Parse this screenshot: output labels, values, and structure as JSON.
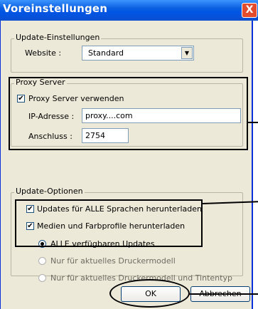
{
  "window": {
    "title": "Voreinstellungen",
    "close_glyph": "X"
  },
  "update_settings": {
    "legend": "Update-Einstellungen",
    "website_label": "Website :",
    "website_value": "Standard",
    "dropdown_glyph": "▼"
  },
  "proxy": {
    "legend": "Proxy Server",
    "use_proxy_label": "Proxy Server verwenden",
    "use_proxy_checked": true,
    "ip_label": "IP-Adresse :",
    "ip_value": "proxy....com",
    "port_label": "Anschluss :",
    "port_value": "2754"
  },
  "update_options": {
    "legend": "Update-Optionen",
    "all_languages_label": "Updates für ALLE Sprachen herunterladen",
    "all_languages_checked": true,
    "media_profiles_label": "Medien und Farbprofile herunterladen",
    "media_profiles_checked": true,
    "radio_all": "ALLE verfügbaren Updates",
    "radio_printer": "Nur für aktuelles Druckermodell",
    "radio_printer_ink": "Nur für aktuelles Druckermodell und Tintentyp",
    "check_glyph": "✔"
  },
  "buttons": {
    "ok": "OK",
    "cancel": "Abbrechen"
  }
}
